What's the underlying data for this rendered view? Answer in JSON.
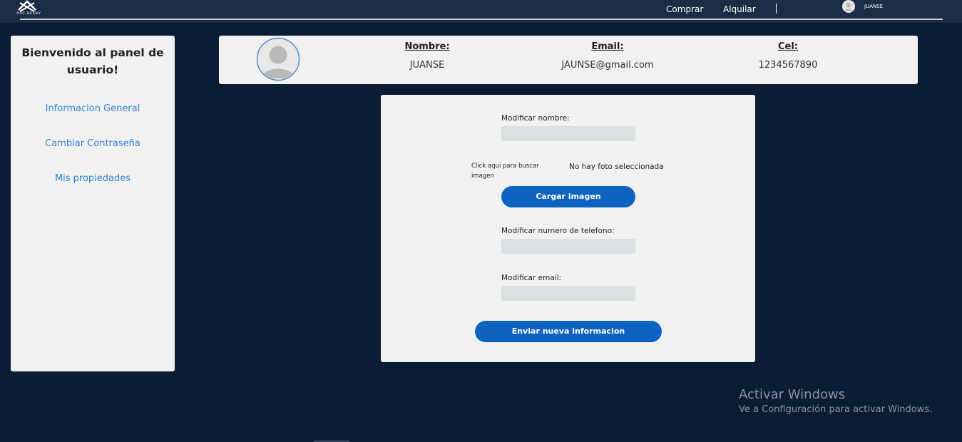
{
  "navbar": {
    "logo_text": "NOT HENRY",
    "links": [
      "Comprar",
      "Alquilar"
    ],
    "username": "JUANSE",
    "icons": [
      "logo-icon",
      "user-avatar-icon"
    ]
  },
  "sidebar": {
    "title": "Bienvenido al panel de usuario!",
    "items": [
      {
        "label": "Informacion General"
      },
      {
        "label": "Cambiar Contraseña"
      },
      {
        "label": "Mis propiedades"
      }
    ]
  },
  "profile": {
    "name_label": "Nombre:",
    "name_value": "JUANSE",
    "email_label": "Email:",
    "email_value": "JAUNSE@gmail.com",
    "cel_label": "Cel:",
    "cel_value": "1234567890"
  },
  "form": {
    "name_label": "Modificar nombre:",
    "name_value": "",
    "image_pick_label": "Click aqui para buscar imagen",
    "image_status": "No hay foto seleccionada",
    "upload_button": "Cargar imagen",
    "phone_label": "Modificar numero de telefono:",
    "phone_value": "",
    "email_label": "Modificar email:",
    "email_value": "",
    "submit_button": "Enviar nueva informacion"
  },
  "watermark": {
    "title": "Activar Windows",
    "subtitle": "Ve a Configuración para activar Windows."
  },
  "colors": {
    "background": "#0b1c35",
    "navbar": "#1b2c45",
    "card": "#f1f1f0",
    "link": "#2f7fd6",
    "button": "#0f63c0",
    "input": "#dde0e3"
  }
}
